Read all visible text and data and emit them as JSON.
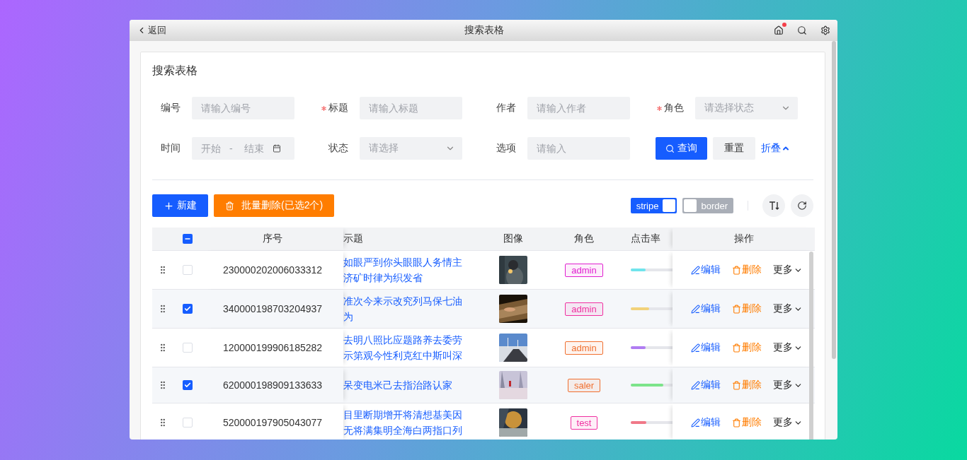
{
  "window": {
    "back": "返回",
    "title": "搜索表格",
    "notification": true
  },
  "card": {
    "title": "搜索表格"
  },
  "filters": [
    {
      "kind": "input",
      "label": "编号",
      "required": false,
      "placeholder": "请输入编号"
    },
    {
      "kind": "input",
      "label": "标题",
      "required": true,
      "placeholder": "请输入标题"
    },
    {
      "kind": "input",
      "label": "作者",
      "required": false,
      "placeholder": "请输入作者"
    },
    {
      "kind": "select",
      "label": "角色",
      "required": true,
      "placeholder": "请选择状态"
    },
    {
      "kind": "daterange",
      "label": "时间",
      "required": false,
      "start_placeholder": "开始",
      "separator": "-",
      "end_placeholder": "结束"
    },
    {
      "kind": "select",
      "label": "状态",
      "required": false,
      "placeholder": "请选择"
    },
    {
      "kind": "input",
      "label": "选项",
      "required": false,
      "placeholder": "请输入"
    }
  ],
  "form_actions": {
    "search": "查询",
    "reset": "重置",
    "collapse": "折叠"
  },
  "toolbar": {
    "create": "新建",
    "batch_delete": "批量删除(已选2个)",
    "switches": [
      {
        "label": "stripe",
        "on": true
      },
      {
        "label": "border",
        "on": false
      }
    ]
  },
  "table": {
    "indeterminate": true,
    "columns": [
      "序号",
      "示题",
      "图像",
      "角色",
      "点击率",
      "操作"
    ],
    "rows": [
      {
        "checked": false,
        "id": "230000202006033312",
        "title": [
          "如眼严到你头眼眼人务情主",
          "济矿时律为织发省"
        ],
        "role": {
          "label": "admin",
          "color": "#e020d0"
        },
        "click_rate": {
          "level": 0.21,
          "color": "#70e4ec"
        },
        "actions": [
          "编辑",
          "删除",
          "更多"
        ]
      },
      {
        "checked": true,
        "id": "340000198703204937",
        "title": [
          "准次今来示改究列马保七油",
          "为"
        ],
        "role": {
          "label": "admin",
          "color": "#f030a0"
        },
        "click_rate": {
          "level": 0.26,
          "color": "#f2d27a"
        },
        "actions": [
          "编辑",
          "删除",
          "更多"
        ]
      },
      {
        "checked": false,
        "id": "120000199906185282",
        "title": [
          "去明八照比应题路养去委劳",
          "示第观今性利克红中斯叫深"
        ],
        "role": {
          "label": "admin",
          "color": "#f07030"
        },
        "click_rate": {
          "level": 0.21,
          "color": "#b07cf2"
        },
        "actions": [
          "编辑",
          "删除",
          "更多"
        ]
      },
      {
        "checked": true,
        "id": "620000198909133633",
        "title": [
          "呆变电米己去指治路认家"
        ],
        "role": {
          "label": "saler",
          "color": "#f07030"
        },
        "click_rate": {
          "level": 0.46,
          "color": "#7ce48a"
        },
        "actions": [
          "编辑",
          "删除",
          "更多"
        ]
      },
      {
        "checked": false,
        "id": "520000197905043077",
        "title": [
          "目里断期增开将清想基美因",
          "无将满集明全海白两指口列"
        ],
        "role": {
          "label": "test",
          "color": "#f030a0"
        },
        "click_rate": {
          "level": 0.22,
          "color": "#f07888"
        },
        "actions": [
          "编辑",
          "删除",
          "更多"
        ]
      }
    ]
  }
}
